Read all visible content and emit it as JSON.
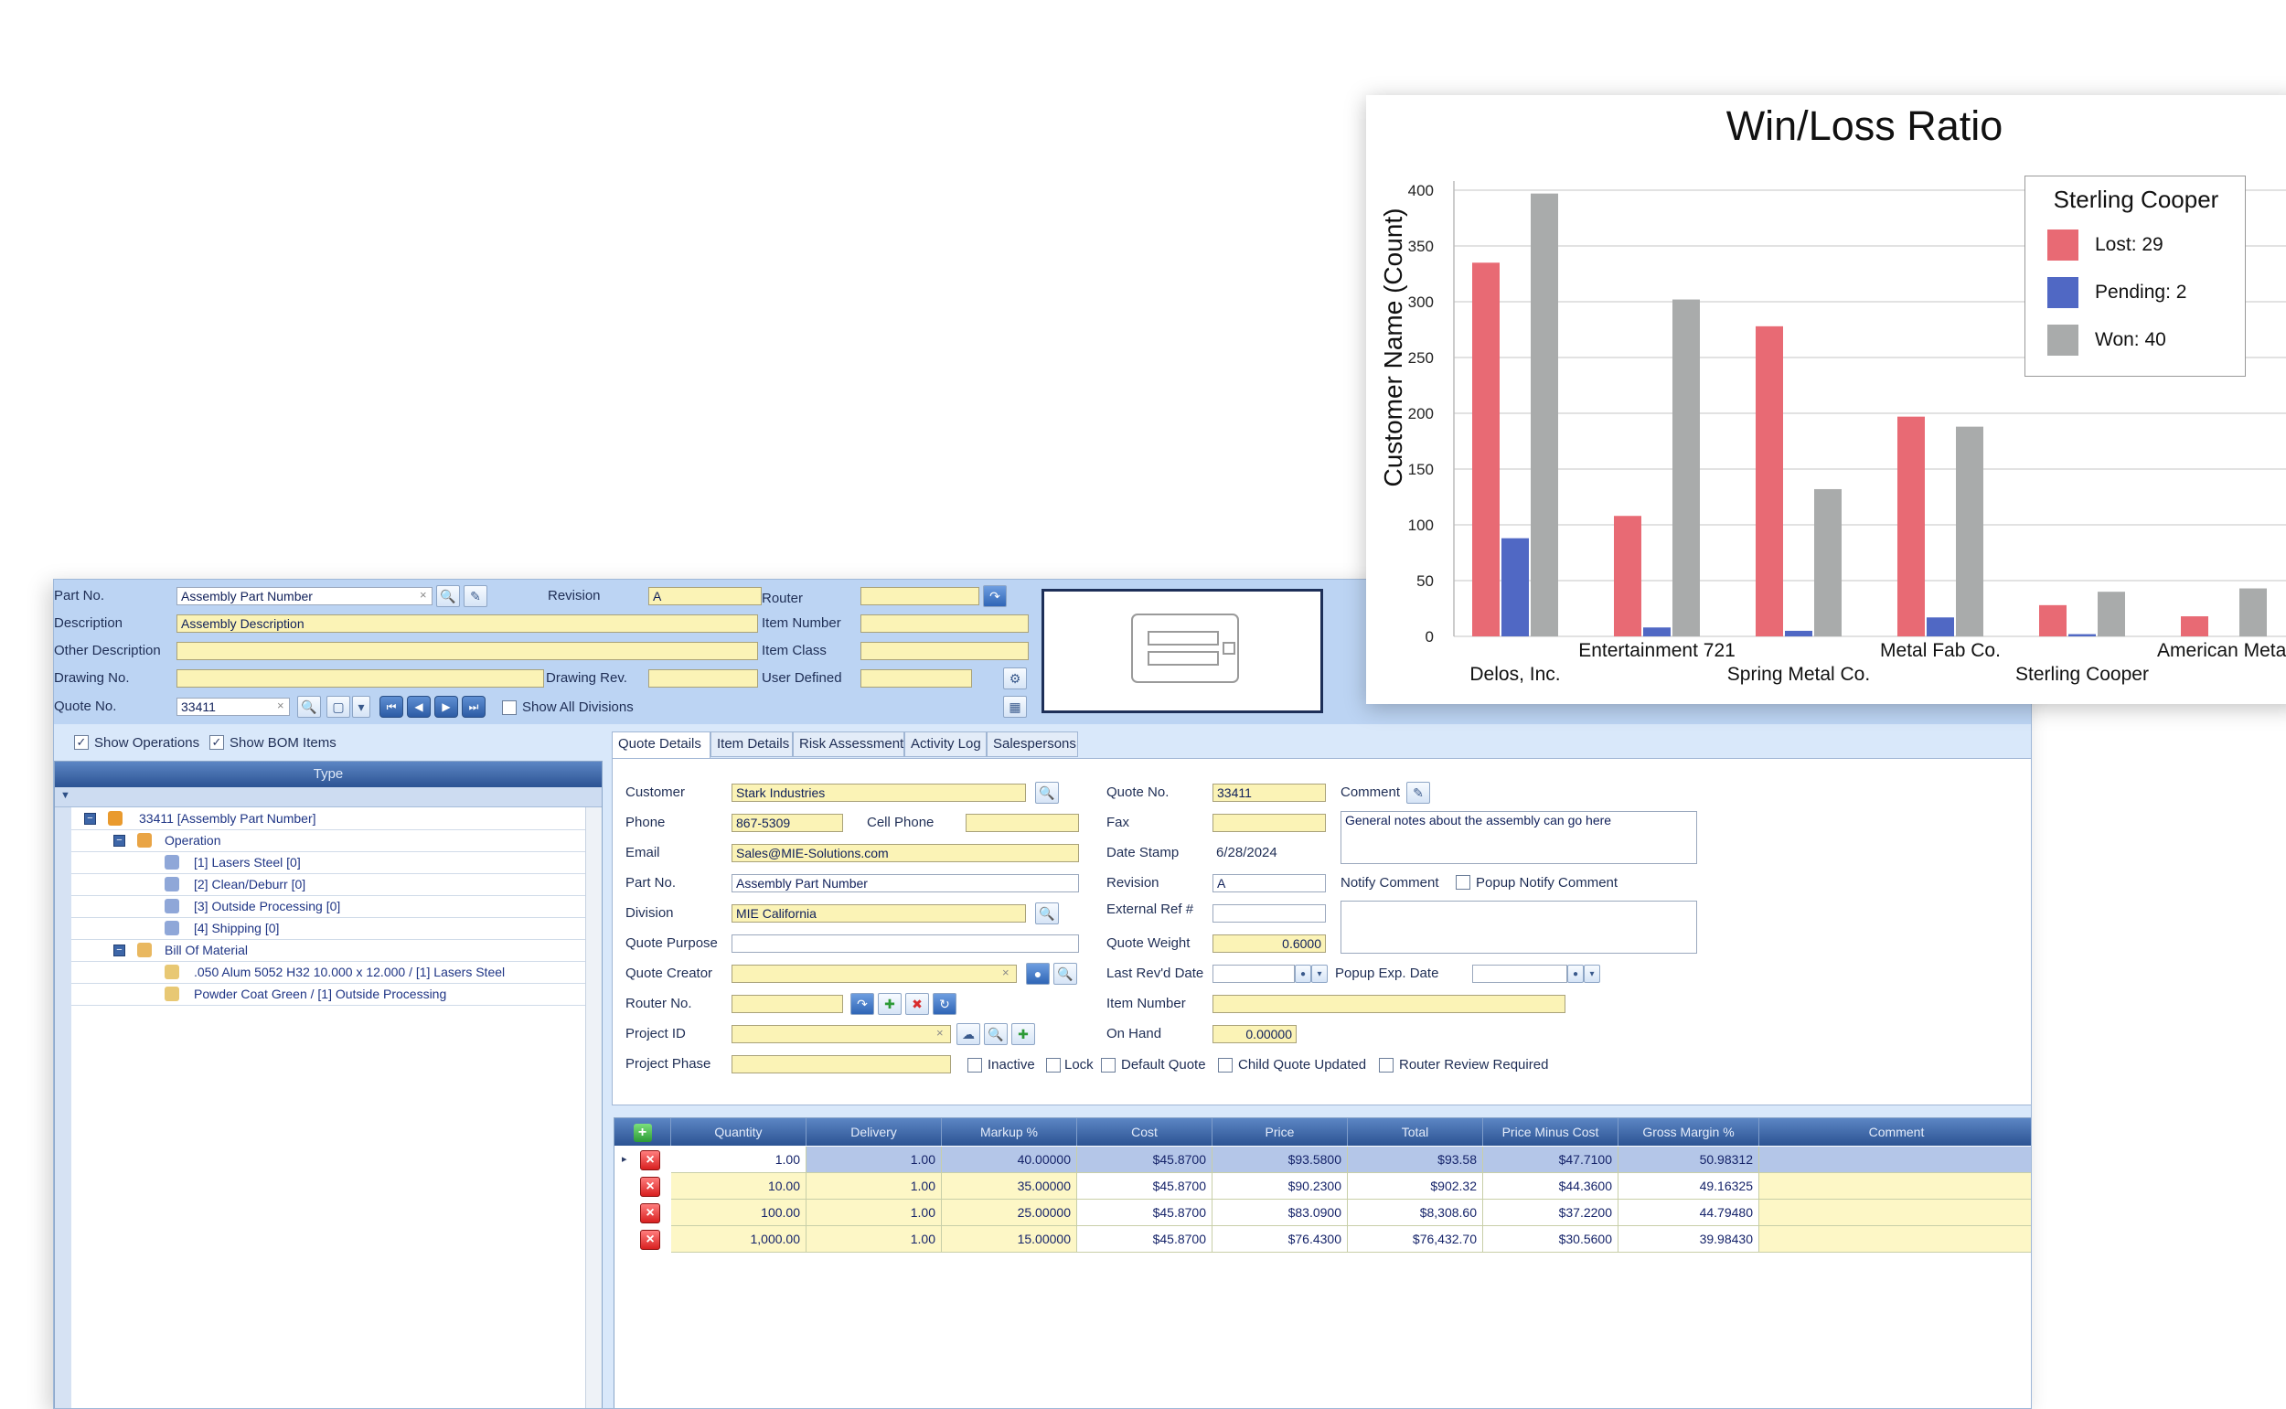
{
  "form": {
    "part_no_label": "Part No.",
    "part_no_value": "Assembly Part Number",
    "revision_label": "Revision",
    "revision_value": "A",
    "router_label": "Router",
    "description_label": "Description",
    "description_value": "Assembly Description",
    "item_number_label": "Item Number",
    "other_description_label": "Other Description",
    "item_class_label": "Item Class",
    "drawing_no_label": "Drawing No.",
    "drawing_rev_label": "Drawing Rev.",
    "user_defined_label": "User Defined",
    "quote_no_label": "Quote No.",
    "quote_no_value": "33411",
    "show_all_divisions_label": "Show All Divisions",
    "clear_glyph": "×"
  },
  "tree": {
    "show_operations_label": "Show Operations",
    "show_bom_label": "Show BOM Items",
    "column_header": "Type",
    "filter_glyph": "▼",
    "items": [
      {
        "label": "33411 [Assembly Part Number]"
      },
      {
        "label": "Operation"
      },
      {
        "label": "[1] Lasers Steel [0]"
      },
      {
        "label": "[2] Clean/Deburr [0]"
      },
      {
        "label": "[3] Outside Processing [0]"
      },
      {
        "label": "[4] Shipping [0]"
      },
      {
        "label": "Bill Of Material"
      },
      {
        "label": ".050 Alum 5052 H32 10.000 x 12.000 / [1] Lasers Steel"
      },
      {
        "label": "Powder Coat Green / [1] Outside Processing"
      }
    ]
  },
  "tabs": [
    {
      "label": "Quote Details"
    },
    {
      "label": "Item Details"
    },
    {
      "label": "Risk Assessment"
    },
    {
      "label": "Activity Log"
    },
    {
      "label": "Salespersons"
    }
  ],
  "details": {
    "customer_label": "Customer",
    "customer_value": "Stark Industries",
    "phone_label": "Phone",
    "phone_value": "867-5309",
    "cell_phone_label": "Cell Phone",
    "email_label": "Email",
    "email_value": "Sales@MIE-Solutions.com",
    "part_no_label": "Part No.",
    "part_no_value": "Assembly Part Number",
    "division_label": "Division",
    "division_value": "MIE California",
    "quote_purpose_label": "Quote Purpose",
    "quote_creator_label": "Quote Creator",
    "router_no_label": "Router No.",
    "project_id_label": "Project ID",
    "project_phase_label": "Project Phase",
    "quote_no_label": "Quote No.",
    "quote_no_value": "33411",
    "fax_label": "Fax",
    "date_stamp_label": "Date Stamp",
    "date_stamp_value": "6/28/2024",
    "revision_label": "Revision",
    "revision_value": "A",
    "external_ref_label": "External Ref #",
    "quote_weight_label": "Quote Weight",
    "quote_weight_value": "0.6000",
    "last_revd_label": "Last Rev'd Date",
    "item_number_label": "Item Number",
    "on_hand_label": "On Hand",
    "on_hand_value": "0.00000",
    "comment_label": "Comment",
    "comment_value": "General notes about the assembly can go here",
    "notify_comment_label": "Notify Comment",
    "popup_notify_label": "Popup Notify Comment",
    "popup_exp_label": "Popup Exp. Date",
    "inactive_label": "Inactive",
    "lock_label": "Lock",
    "default_quote_label": "Default Quote",
    "child_quote_label": "Child Quote Updated",
    "router_review_label": "Router Review Required"
  },
  "grid": {
    "add_glyph": "+",
    "delete_glyph": "×",
    "headers": [
      "Quantity",
      "Delivery",
      "Markup %",
      "Cost",
      "Price",
      "Total",
      "Price Minus Cost",
      "Gross Margin %",
      "Comment"
    ],
    "rows": [
      [
        "1.00",
        "1.00",
        "40.00000",
        "$45.8700",
        "$93.5800",
        "$93.58",
        "$47.7100",
        "50.98312",
        ""
      ],
      [
        "10.00",
        "1.00",
        "35.00000",
        "$45.8700",
        "$90.2300",
        "$902.32",
        "$44.3600",
        "49.16325",
        ""
      ],
      [
        "100.00",
        "1.00",
        "25.00000",
        "$45.8700",
        "$83.0900",
        "$8,308.60",
        "$37.2200",
        "44.79480",
        ""
      ],
      [
        "1,000.00",
        "1.00",
        "15.00000",
        "$45.8700",
        "$76.4300",
        "$76,432.70",
        "$30.5600",
        "39.98430",
        ""
      ]
    ]
  },
  "chart_data": {
    "type": "bar",
    "title": "Win/Loss Ratio",
    "xlabel": "",
    "ylabel": "Customer Name (Count)",
    "ylim": [
      0,
      400
    ],
    "yticks": [
      0,
      50,
      100,
      150,
      200,
      250,
      300,
      350,
      400
    ],
    "grid": true,
    "legend_placement": "top-right",
    "categories": [
      "Delos, Inc.",
      "Entertainment 721",
      "Spring Metal Co.",
      "Metal Fab Co.",
      "Sterling Cooper",
      "American Metal"
    ],
    "series": [
      {
        "name": "Lost",
        "color": "#e86a74",
        "values": [
          335,
          108,
          278,
          197,
          28,
          18
        ]
      },
      {
        "name": "Pending",
        "color": "#5068c4",
        "values": [
          88,
          8,
          5,
          17,
          2,
          0
        ]
      },
      {
        "name": "Won",
        "color": "#a9abab",
        "values": [
          397,
          302,
          132,
          188,
          40,
          43
        ]
      }
    ],
    "legend": {
      "title": "Sterling Cooper",
      "entries": [
        "Lost: 29",
        "Pending: 2",
        "Won: 40"
      ]
    }
  }
}
